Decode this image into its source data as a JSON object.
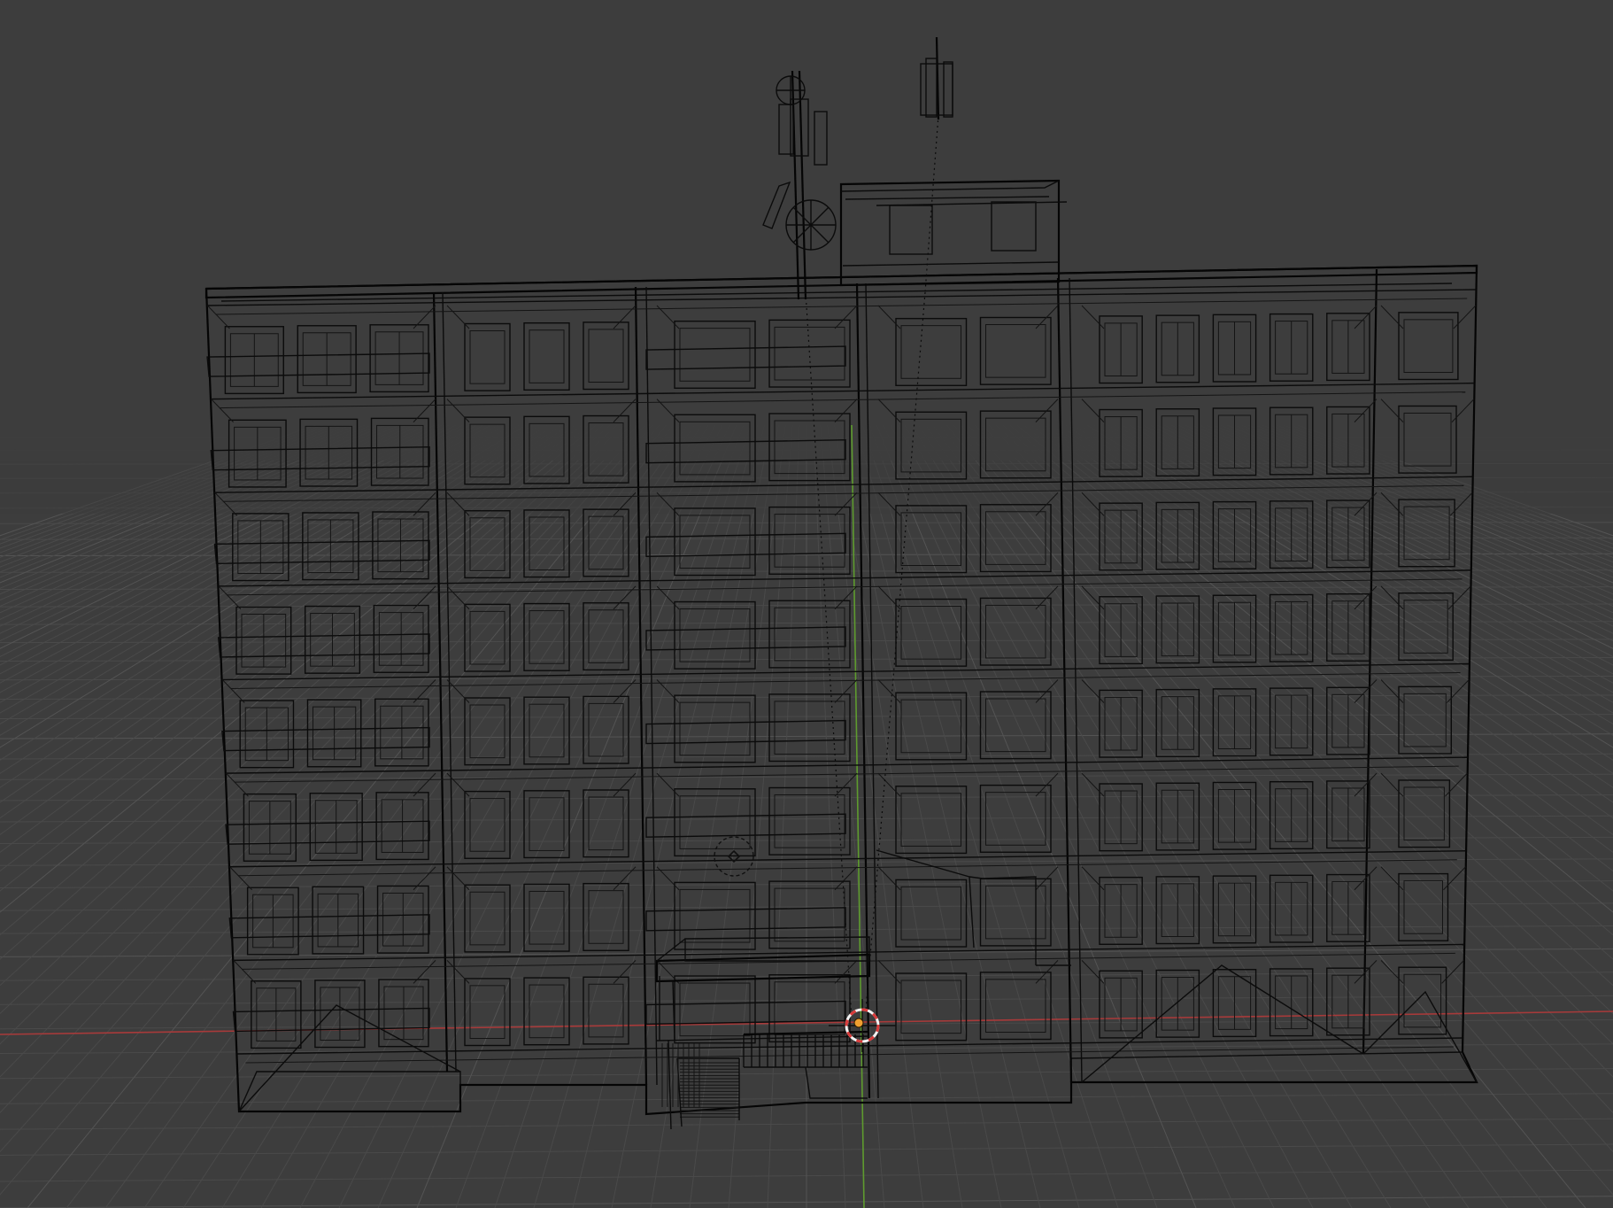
{
  "viewport": {
    "mode": "wireframe",
    "colors": {
      "background": "#3d3d3d",
      "grid_line": "#4a4a4a",
      "grid_line_major": "#545454",
      "x_axis": "#a83a3a",
      "y_axis": "#5e9b2e",
      "wireframe": "#0b0b0b",
      "origin_dot": "#f0a030",
      "cursor_ring_red": "#d93a3a",
      "cursor_ring_white": "#f2f2f2"
    }
  },
  "scene": {
    "object": "apartment-building-wireframe",
    "floors": 8,
    "antenna_masts": 2
  },
  "icons": {
    "cursor": "3d-cursor-icon",
    "origin": "object-origin-icon",
    "light": "light-empty-icon"
  }
}
